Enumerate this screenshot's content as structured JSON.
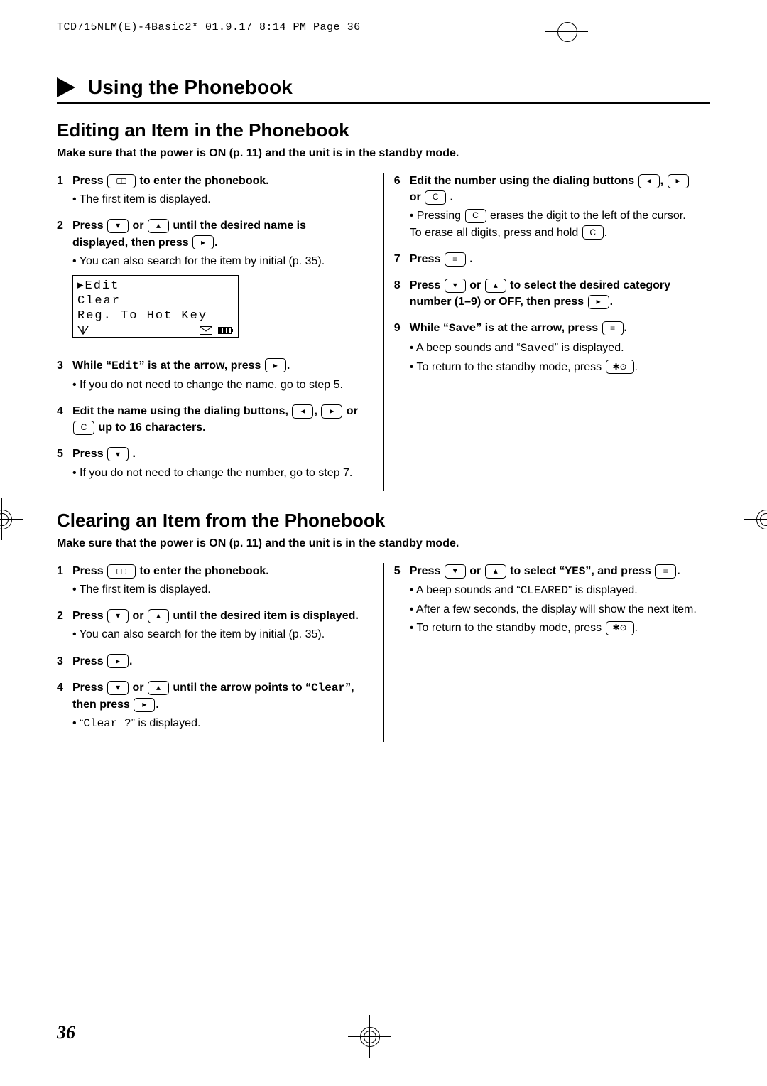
{
  "print_header": "TCD715NLM(E)-4Basic2*  01.9.17 8:14 PM  Page 36",
  "section_banner": "Using the Phonebook",
  "page_number": "36",
  "edit": {
    "heading": "Editing an Item in the Phonebook",
    "precondition": "Make sure that the power is ON (p. 11) and the unit is in the standby mode.",
    "lcd": {
      "line1": "▸Edit",
      "line2": " Clear",
      "line3": " Reg. To Hot Key"
    },
    "steps_left": [
      {
        "num": "1",
        "main_a": "Press ",
        "main_b": " to enter the phonebook.",
        "subs": [
          "The first item is displayed."
        ]
      },
      {
        "num": "2",
        "main_a": "Press ",
        "main_mid": " or ",
        "main_b": " until the desired name is displayed, then press ",
        "subs": [
          "You can also search for the item by initial (p. 35)."
        ]
      },
      {
        "num": "3",
        "main_a": "While “",
        "main_code": "Edit",
        "main_b": "” is at the arrow, press ",
        "subs": [
          "If you do not need to change the name, go to step 5."
        ]
      },
      {
        "num": "4",
        "main_a": "Edit the name using the dialing buttons, ",
        "main_b": " up to 16 characters.",
        "subs": []
      },
      {
        "num": "5",
        "main_a": "Press ",
        "main_b": " .",
        "subs": [
          "If you do not need to change the number, go to step 7."
        ]
      }
    ],
    "steps_right": [
      {
        "num": "6",
        "main_a": "Edit the number using the dialing buttons ",
        "main_b": " .",
        "subs": [
          "Pressing  C  erases the digit to the left of the cursor. To erase all digits, press and hold  C  ."
        ]
      },
      {
        "num": "7",
        "main_a": "Press ",
        "main_b": ".",
        "subs": []
      },
      {
        "num": "8",
        "main_a": "Press ",
        "main_mid": " or ",
        "main_b": " to select the desired category number (1–9) or OFF, then press ",
        "subs": []
      },
      {
        "num": "9",
        "main_a": "While “",
        "main_code": "Save",
        "main_b": "” is at the arrow, press ",
        "subs": [
          "A beep sounds and “Saved” is displayed.",
          "To return to the standby mode, press  ✱⊙  ."
        ]
      }
    ]
  },
  "clear": {
    "heading": "Clearing an Item from the Phonebook",
    "precondition": "Make sure that the power is ON (p. 11) and the unit is in the standby mode.",
    "steps_left": [
      {
        "num": "1",
        "main_a": "Press ",
        "main_b": " to enter the phonebook.",
        "subs": [
          "The first item is displayed."
        ]
      },
      {
        "num": "2",
        "main_a": "Press ",
        "main_mid": " or ",
        "main_b": " until the desired item is displayed.",
        "subs": [
          "You can also search for the item by initial (p. 35)."
        ]
      },
      {
        "num": "3",
        "main_a": "Press",
        "main_b": ".",
        "subs": []
      },
      {
        "num": "4",
        "main_a": "Press ",
        "main_mid": " or ",
        "main_b": " until the arrow points to “",
        "main_code": "Clear",
        "main_c": "”, then press ",
        "subs": [
          "“Clear ?” is displayed."
        ]
      }
    ],
    "steps_right": [
      {
        "num": "5",
        "main_a": "Press ",
        "main_mid": " or ",
        "main_b": " to select “",
        "main_code": "YES",
        "main_c": "”, and press ",
        "subs": [
          "A beep sounds and “CLEARED” is displayed.",
          "After a few seconds, the display will show the next item.",
          "To return to the standby mode, press  ✱⊙  ."
        ]
      }
    ]
  },
  "keys": {
    "phonebook": "⌕",
    "down": "▾",
    "up": "▴",
    "right": "▸",
    "left": "◂",
    "c": "C",
    "menu": "≡",
    "power": "✱⊙"
  }
}
